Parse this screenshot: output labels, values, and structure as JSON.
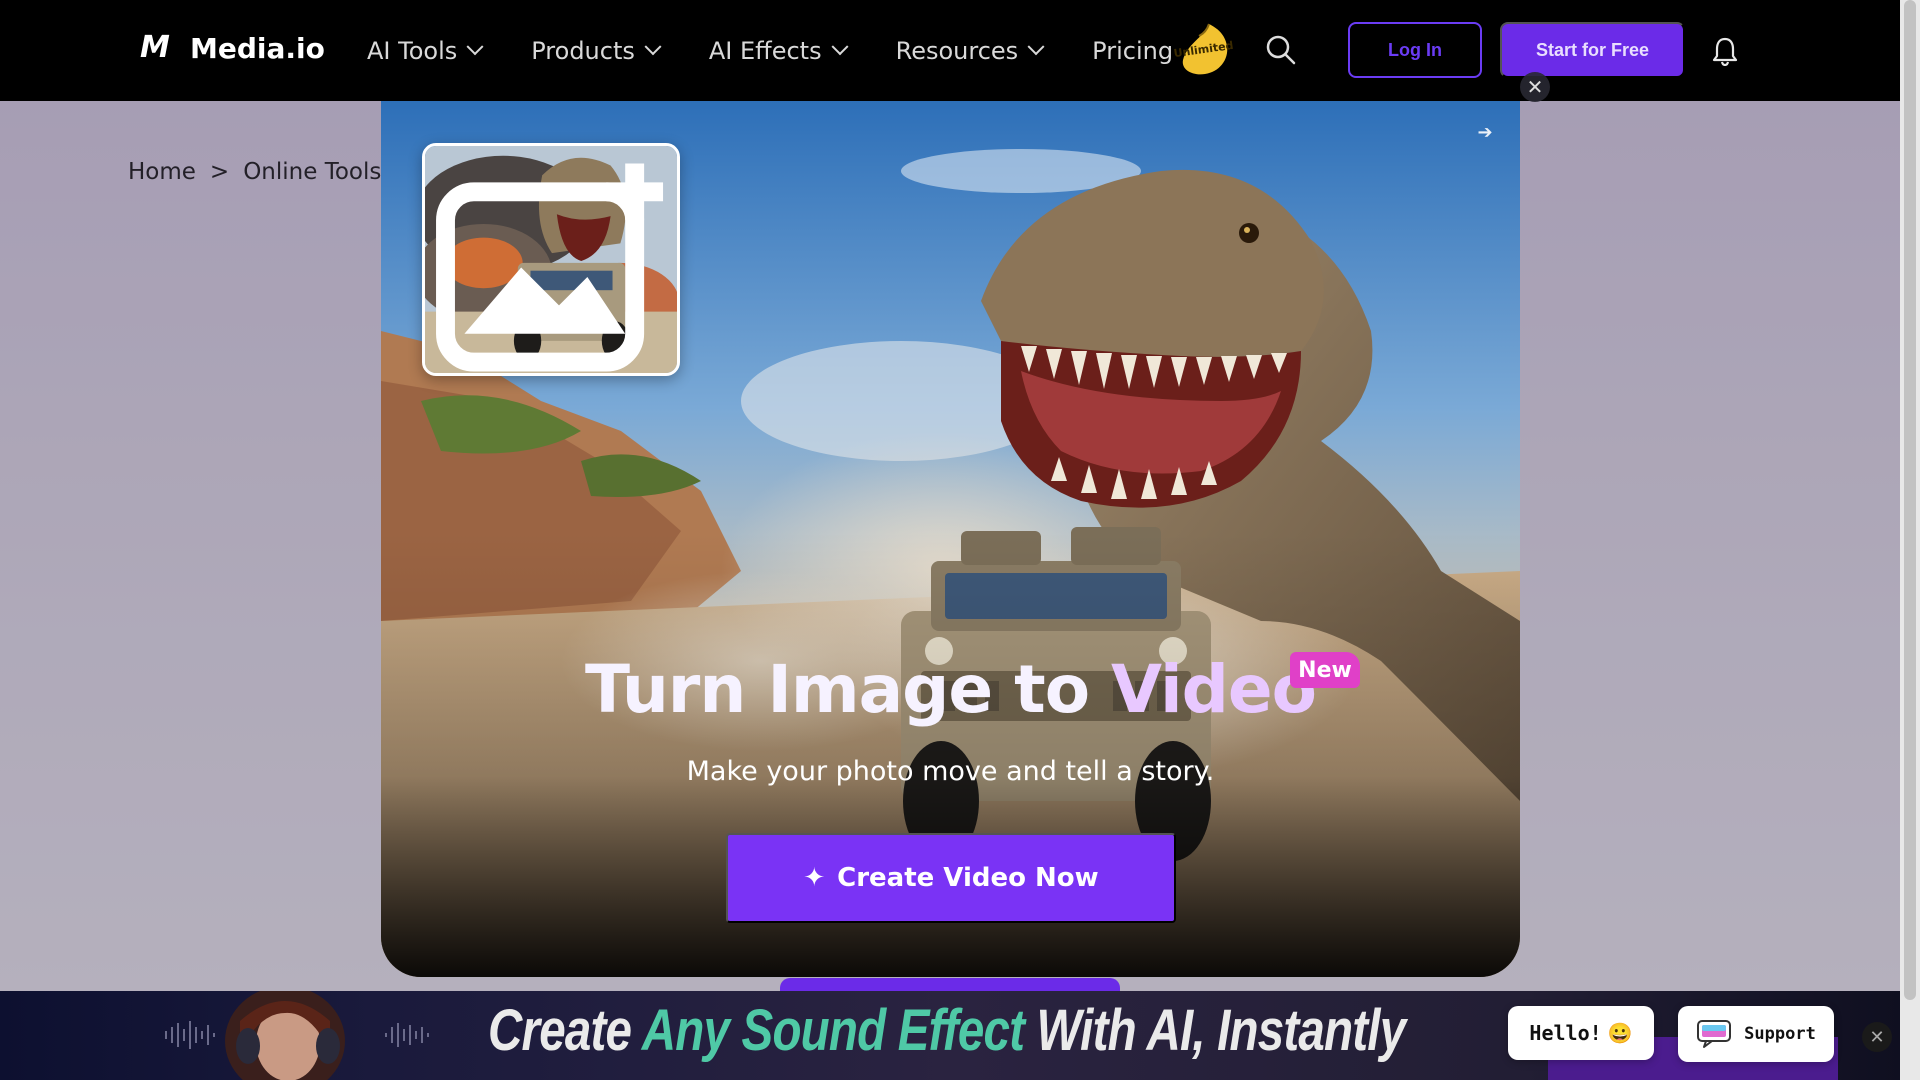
{
  "nav": {
    "logo_text": "Media.io",
    "logo_mark": "M",
    "items": [
      {
        "label": "AI Tools",
        "has_dropdown": true
      },
      {
        "label": "Products",
        "has_dropdown": true
      },
      {
        "label": "AI Effects",
        "has_dropdown": true
      },
      {
        "label": "Resources",
        "has_dropdown": true
      },
      {
        "label": "Pricing",
        "has_dropdown": false
      }
    ],
    "badge_text": "Unlimited",
    "login_label": "Log In",
    "start_label": "Start for Free",
    "icons": {
      "search": "search-icon",
      "bell": "bell-icon"
    }
  },
  "breadcrumb": {
    "items": [
      "Home",
      "Online Tools"
    ],
    "separator": ">"
  },
  "modal": {
    "headline_part1": "Turn Image to ",
    "headline_part2": "Video",
    "badge": "New",
    "subline": "Make your photo move and tell a story.",
    "cta_label": "Create Video Now",
    "cta_icon": "sparkle-icon",
    "close_symbol": "✕",
    "next_symbol": "➔",
    "colors": {
      "cta": "#7a33f5",
      "badge": "#e040c8",
      "headline_accent": "#e8c8ff"
    }
  },
  "banner": {
    "text_part1": "Create ",
    "text_part2": "Any Sound Effect",
    "text_part3": " With AI, Instantly",
    "hello_text": "Hello!",
    "hello_emoji": "😀",
    "support_label": "Support",
    "close_symbol": "✕",
    "colors": {
      "accent": "#4fc9a6"
    }
  }
}
